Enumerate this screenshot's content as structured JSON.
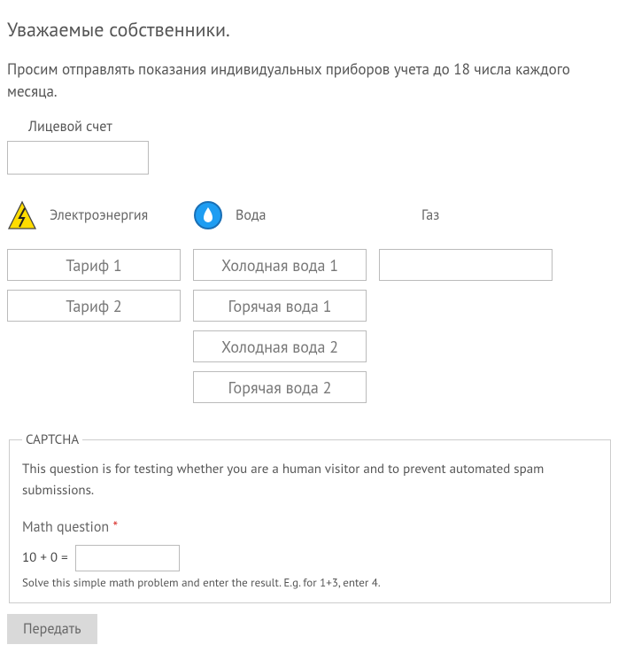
{
  "heading": "Уважаемые собственники.",
  "intro": "Просим отправлять показания индивидуальных приборов учета до 18 числа каждого месяца.",
  "account": {
    "label": "Лицевой счет",
    "value": ""
  },
  "columns": {
    "electricity": {
      "label": "Электроэнергия",
      "inputs": [
        {
          "placeholder": "Тариф 1",
          "value": ""
        },
        {
          "placeholder": "Тариф 2",
          "value": ""
        }
      ]
    },
    "water": {
      "label": "Вода",
      "inputs": [
        {
          "placeholder": "Холодная вода 1",
          "value": ""
        },
        {
          "placeholder": "Горячая вода 1",
          "value": ""
        },
        {
          "placeholder": "Холодная вода 2",
          "value": ""
        },
        {
          "placeholder": "Горячая вода 2",
          "value": ""
        }
      ]
    },
    "gas": {
      "label": "Газ",
      "inputs": [
        {
          "placeholder": "",
          "value": ""
        }
      ]
    }
  },
  "captcha": {
    "legend": "CAPTCHA",
    "description": "This question is for testing whether you are a human visitor and to prevent automated spam submissions.",
    "math_label": "Math question",
    "required_marker": "*",
    "math_expression": "10 + 0 =",
    "math_value": "",
    "math_help": "Solve this simple math problem and enter the result. E.g. for 1+3, enter 4."
  },
  "submit_label": "Передать"
}
